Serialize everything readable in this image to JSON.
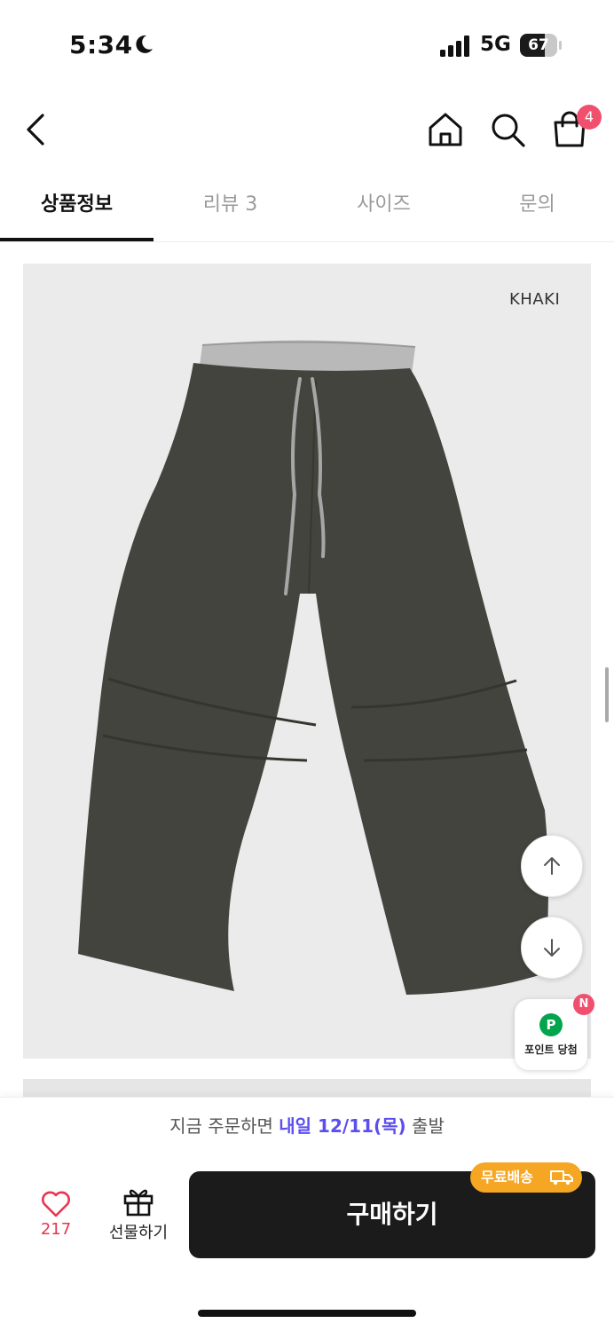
{
  "status_bar": {
    "time": "5:34",
    "network": "5G",
    "battery": "67",
    "battery_level": 0.67
  },
  "header": {
    "cart_count": "4"
  },
  "tabs": [
    {
      "label": "상품정보",
      "active": true
    },
    {
      "label": "리뷰 3",
      "active": false
    },
    {
      "label": "사이즈",
      "active": false
    },
    {
      "label": "문의",
      "active": false
    }
  ],
  "product": {
    "color_label": "KHAKI"
  },
  "point_widget": {
    "icon_letter": "P",
    "badge": "N",
    "label": "포인트 당첨"
  },
  "shipping": {
    "prefix": "지금 주문하면 ",
    "highlight": "내일 12/11(목)",
    "suffix": " 출발"
  },
  "action_bar": {
    "like_count": "217",
    "gift_label": "선물하기",
    "buy_label": "구매하기",
    "free_shipping_label": "무료배송"
  },
  "colors": {
    "accent": "#5b4df0",
    "badge": "#f0506e",
    "buy_button": "#1b1b1b",
    "free_badge": "#f5a623",
    "point_green": "#03a44e"
  }
}
